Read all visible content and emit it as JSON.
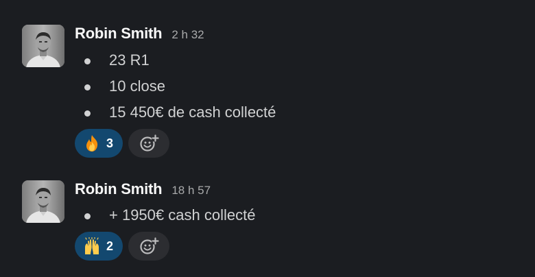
{
  "messages": [
    {
      "author": "Robin Smith",
      "timestamp": "2 h 32",
      "items": [
        "23 R1",
        "10 close",
        "15 450€ de cash collecté"
      ],
      "reaction": {
        "emoji": "fire-emoji",
        "count": "3"
      }
    },
    {
      "author": "Robin Smith",
      "timestamp": "18 h 57",
      "items": [
        "+ 1950€ cash collecté"
      ],
      "reaction": {
        "emoji": "raised-hands-emoji",
        "count": "2"
      }
    }
  ],
  "colors": {
    "background": "#1b1d21",
    "author": "#f8f8f8",
    "text": "#d1d2d3",
    "timestamp": "#a9aaab",
    "reaction_pill": "#13486f",
    "add_reaction_pill": "#2c2d31"
  },
  "icons": {
    "add_reaction": "add-reaction-icon"
  }
}
